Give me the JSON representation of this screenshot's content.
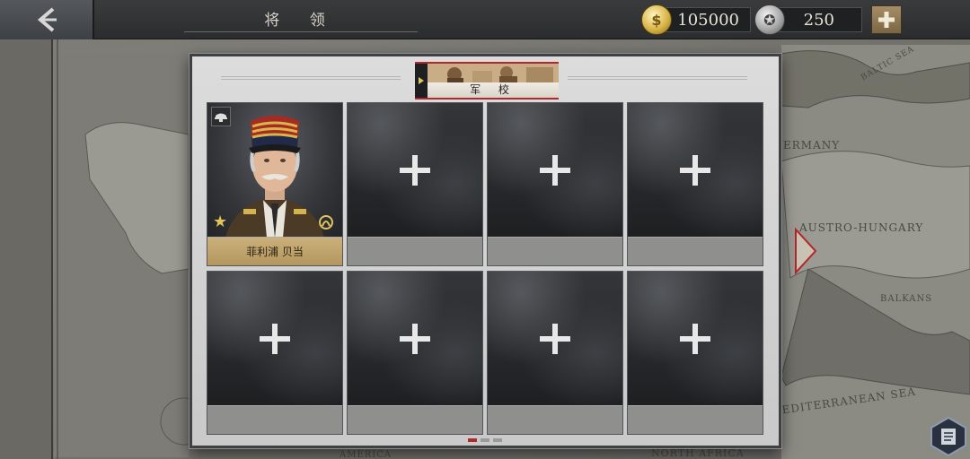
{
  "header": {
    "title": "将 领",
    "gold_amount": "105000",
    "medal_amount": "250",
    "back_icon": "chevron-left-icon",
    "add_icon": "plus-icon"
  },
  "map": {
    "labels": [
      "ERMANY",
      "AUSTRO-HUNGARY",
      "BALKANS",
      "EDITERRANEAN SEA",
      "NORTH AFRICA",
      "AMERICA",
      "BALTIC SEA"
    ]
  },
  "panel": {
    "tab_label": "军 校",
    "slots": [
      {
        "filled": true,
        "name": "菲利浦 贝当"
      },
      {
        "filled": false
      },
      {
        "filled": false
      },
      {
        "filled": false
      },
      {
        "filled": false
      },
      {
        "filled": false
      },
      {
        "filled": false
      },
      {
        "filled": false
      }
    ],
    "page_count": 3,
    "current_page": 1
  },
  "colors": {
    "accent_red": "#b3262a",
    "nameplate_gold": "#cbb07a",
    "gold_coin": "#d9b547"
  }
}
